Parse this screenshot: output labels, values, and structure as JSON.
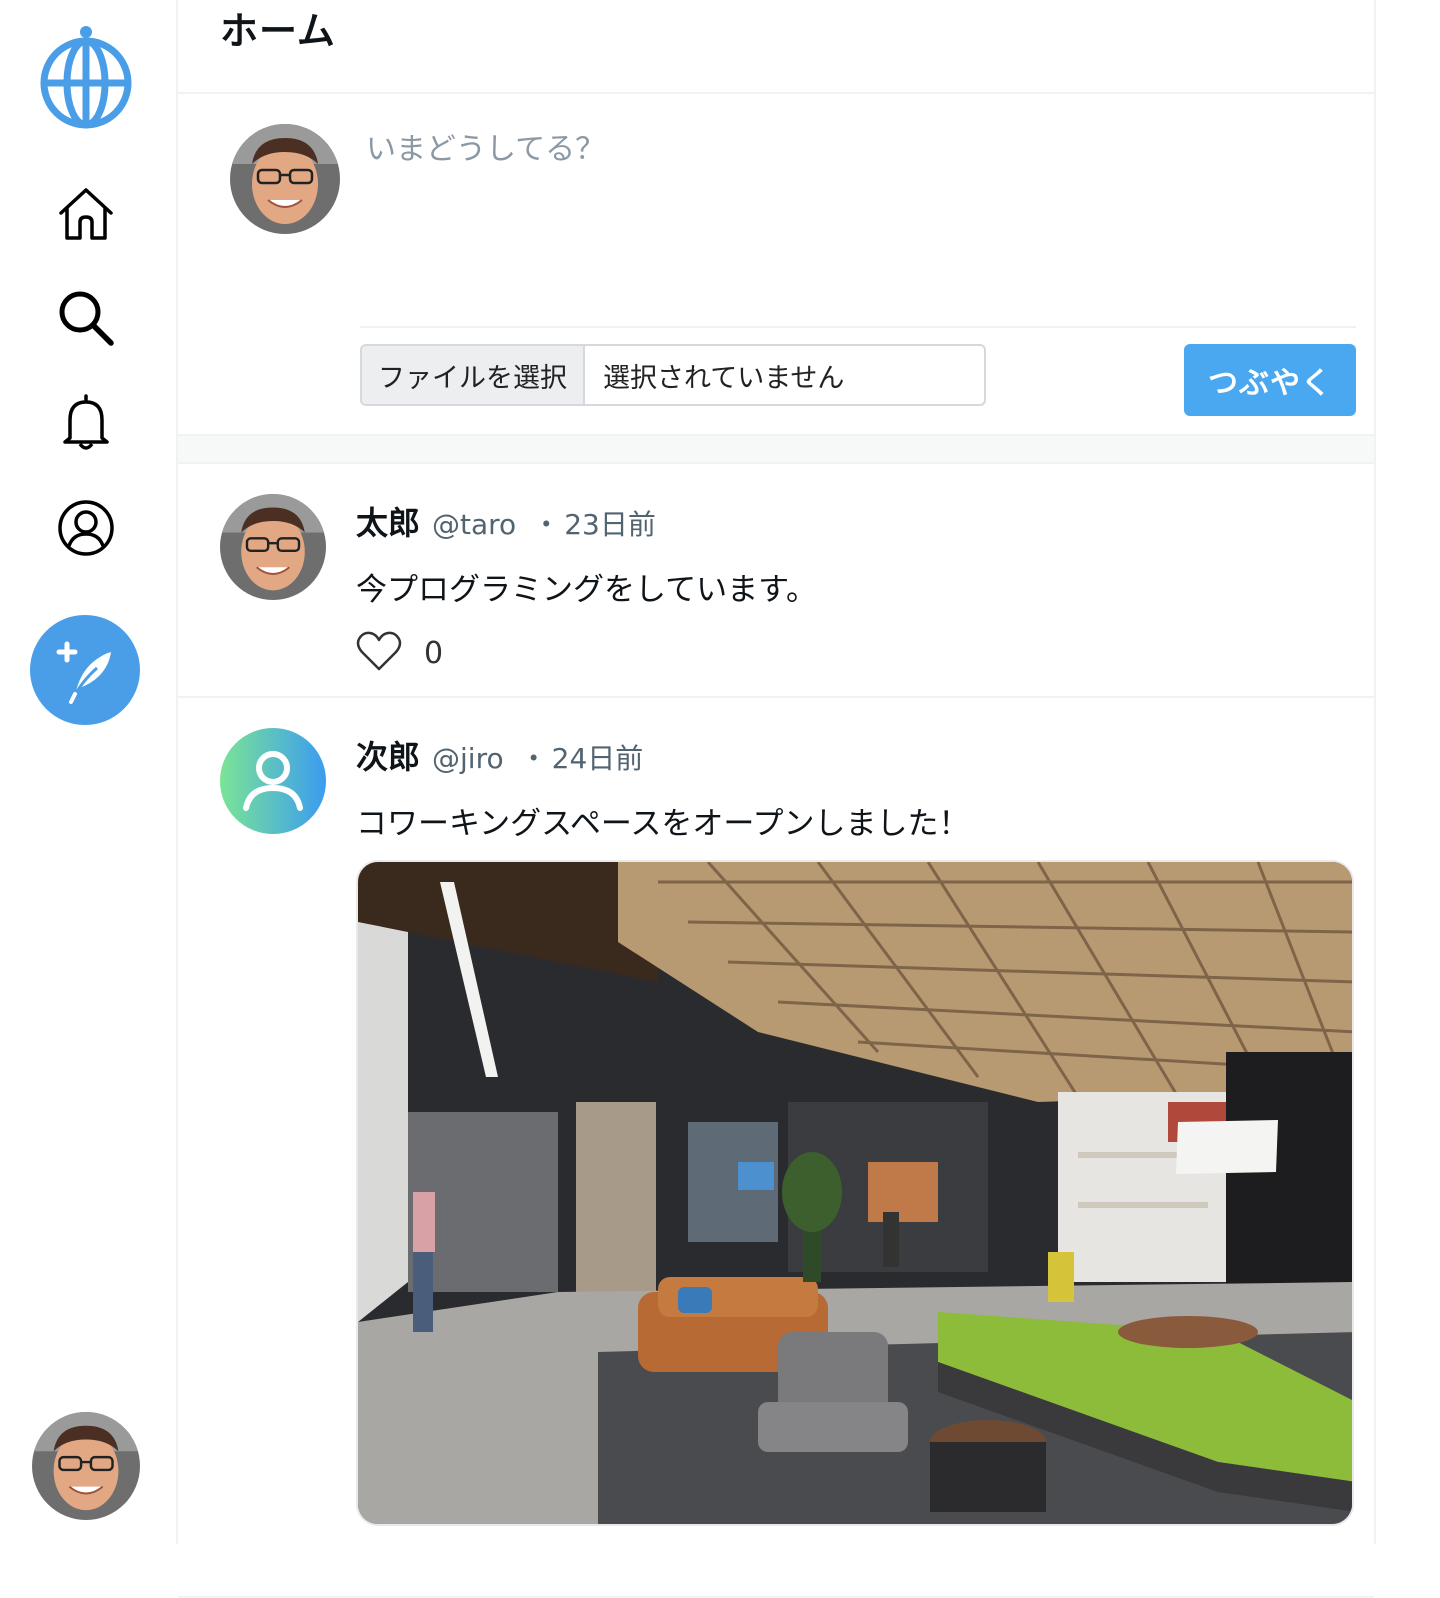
{
  "header": {
    "title": "ホーム"
  },
  "composer": {
    "placeholder": "いまどうしてる？",
    "file_button": "ファイルを選択",
    "file_status": "選択されていません",
    "submit_label": "つぶやく"
  },
  "posts": [
    {
      "name": "太郎",
      "handle": "@taro",
      "separator": "・",
      "time": "23日前",
      "text": "今プログラミングをしています。",
      "likes": "0",
      "avatar": "user-photo"
    },
    {
      "name": "次郎",
      "handle": "@jiro",
      "separator": "・",
      "time": "24日前",
      "text": "コワーキングスペースをオープンしました！",
      "avatar": "default-user-icon",
      "has_image": true
    }
  ],
  "sidebar": {
    "items": [
      "logo-globe-icon",
      "home-icon",
      "search-icon",
      "bell-icon",
      "profile-icon",
      "compose-icon"
    ]
  },
  "colors": {
    "accent": "#4a9ee8",
    "button": "#4aa8f0",
    "border": "#eff3f4",
    "muted_text": "#536471"
  }
}
